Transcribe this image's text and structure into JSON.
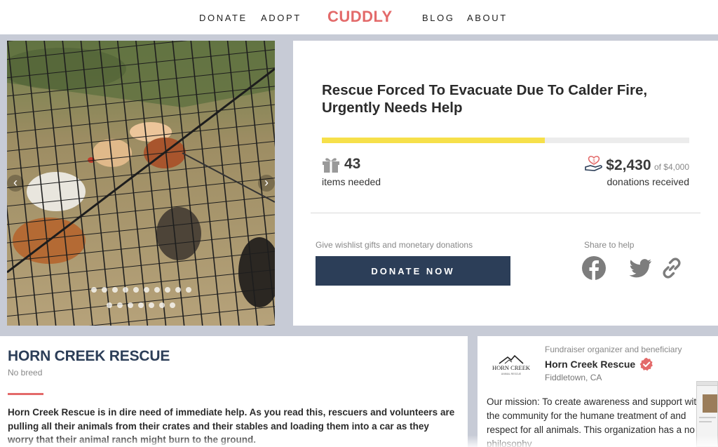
{
  "nav": {
    "left": [
      "DONATE",
      "ADOPT"
    ],
    "logo": "CUDDLY",
    "right": [
      "BLOG",
      "ABOUT"
    ]
  },
  "gallery": {
    "prev_icon": "chevron-left-icon",
    "next_icon": "chevron-right-icon",
    "prev_glyph": "‹",
    "next_glyph": "›",
    "dots_row1": 10,
    "dots_row2": 7
  },
  "fundraiser": {
    "title": "Rescue Forced To Evacuate Due To Calder Fire, Urgently Needs Help",
    "progress_fraction": 0.6075,
    "items_needed": "43",
    "items_label": "items needed",
    "amount": "$2,430",
    "goal": "of $4,000",
    "donations_label": "donations received",
    "give_text": "Give wishlist gifts and monetary donations",
    "donate_button": "DONATE NOW",
    "share_text": "Share to help",
    "share_icons": [
      "facebook-icon",
      "twitter-icon",
      "link-icon"
    ],
    "accent_yellow": "#f6e04a",
    "button_color": "#2c3e58"
  },
  "about": {
    "name": "HORN CREEK RESCUE",
    "breed": "No breed",
    "description": "Horn Creek Rescue is in dire need of immediate help. As you read this, rescuers and volunteers are pulling all their animals from their crates and their stables and loading them into a car as they worry that their animal ranch might burn to the ground."
  },
  "organizer": {
    "role": "Fundraiser organizer and beneficiary",
    "name": "Horn Creek Rescue",
    "location": "Fiddletown, CA",
    "logo_text": "HORN CREEK",
    "logo_subtext": "ANIMAL RESCUE",
    "mission": "Our mission: To create awareness and support within the community for the humane treatment of and respect for all animals. This organization has a no kill philosophy"
  },
  "colors": {
    "brand": "#e36a6a",
    "page_bg": "#c7cbd6"
  }
}
